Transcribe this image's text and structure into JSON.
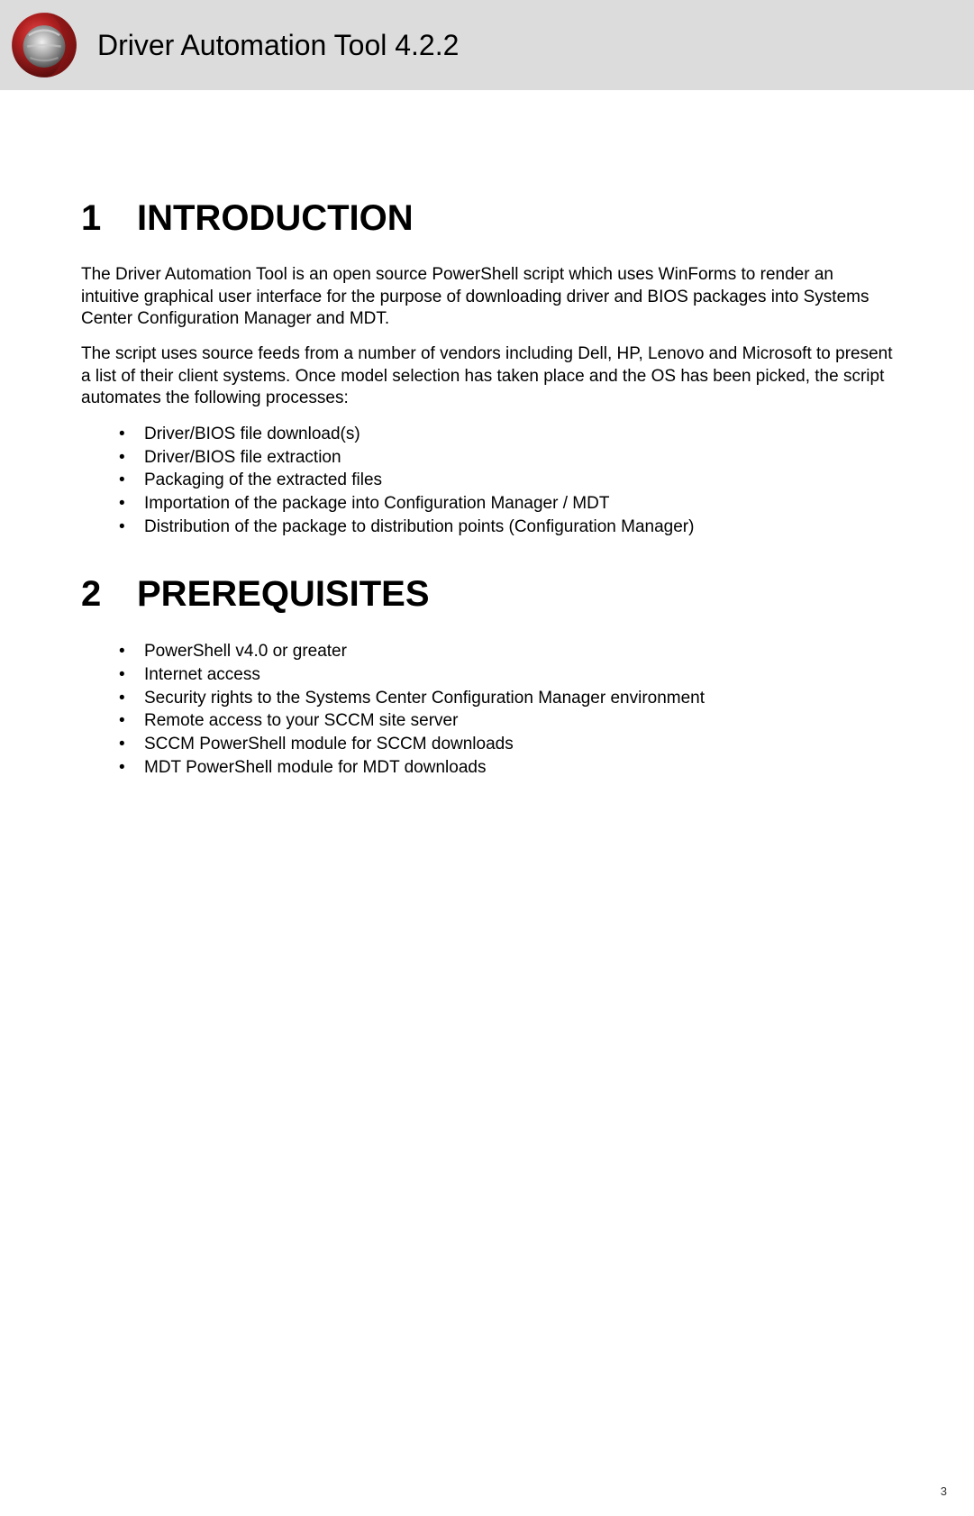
{
  "header": {
    "title": "Driver Automation Tool 4.2.2"
  },
  "sections": {
    "intro": {
      "number": "1",
      "title": "INTRODUCTION",
      "para1": "The Driver Automation Tool is an open source PowerShell script which uses WinForms to render an intuitive graphical user interface for the purpose of downloading driver and BIOS packages into Systems Center Configuration Manager and MDT.",
      "para2": "The script uses source feeds from a number of vendors including Dell, HP, Lenovo and Microsoft to present a list of their client systems. Once model selection has taken place and the OS has been picked, the script automates the following processes:",
      "bullets": [
        "Driver/BIOS file download(s)",
        "Driver/BIOS file extraction",
        "Packaging of the extracted files",
        "Importation of the package into Configuration Manager / MDT",
        "Distribution of the package to distribution points (Configuration Manager)"
      ]
    },
    "prereq": {
      "number": "2",
      "title": "PREREQUISITES",
      "bullets": [
        "PowerShell v4.0 or greater",
        "Internet access",
        "Security rights to the Systems Center Configuration Manager environment",
        "Remote access to your SCCM site server",
        "SCCM PowerShell module for SCCM downloads",
        "MDT PowerShell module for MDT downloads"
      ]
    }
  },
  "page_number": "3"
}
